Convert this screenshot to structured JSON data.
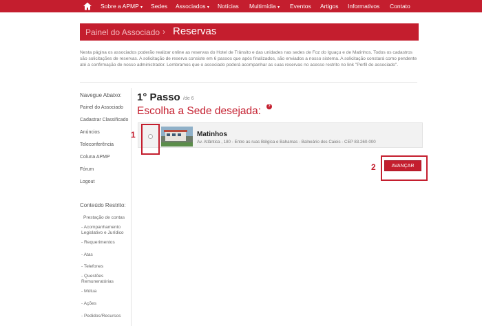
{
  "nav": {
    "items": [
      "Sobre a APMP",
      "Sedes",
      "Associados",
      "Notícias",
      "Multimídia",
      "Eventos",
      "Artigos",
      "Informativos",
      "Contato"
    ],
    "dropdown_items": [
      "Sobre a APMP",
      "Associados",
      "Multimídia"
    ]
  },
  "header": {
    "breadcrumb": "Painel do Associado",
    "separator": "›",
    "title": "Reservas"
  },
  "intro_text": "Nesta página os associados poderão realizar online as reservas do Hotel de Trânsito e das unidades nas sedes de Foz do Iguaçu e de Matinhos. Todos os cadastros são solicitações de reservas. A solicitação de reserva consiste em 6 passos que após finalizados, são enviados a nosso sistema. A solicitação constará como pendente até a confirmação de nosso administrador. Lembramos que o associado poderá acompanhar as suas reservas no acesso restrito no link \"Perfil do associado\".",
  "sidebar": {
    "nav_title": "Navegue Abaixo:",
    "links": [
      "Painel do Associado",
      "Cadastrar Classificado",
      "Anúncios",
      "Teleconferência",
      "Coluna APMP",
      "Fórum",
      "Logout"
    ],
    "restricted_title": "Conteúdo Restrito:",
    "restricted_items": [
      "Prestação de contas",
      "- Acompanhamento Legislativo e Jurídico",
      "- Requerimentos",
      "- Atas",
      "- Telefones",
      "- Questões Remuneratórias",
      "- Mútua",
      "- Ações",
      "- Pedidos/Recursos"
    ]
  },
  "main": {
    "step_title": "1° Passo",
    "step_of": "/de 6",
    "choose_label": "Escolha a Sede desejada:",
    "info_glyph": "?",
    "sede": {
      "name": "Matinhos",
      "address": "Av. Atlântica , 180 - Entre as ruas Bélgica e Bahamas - Balneário dos Caieis - CEP 83.260-000",
      "selected": false
    },
    "next_button": "AVANÇAR"
  },
  "annotations": {
    "marker_1": "1",
    "marker_2": "2"
  },
  "colors": {
    "brand_red": "#c41e2e"
  }
}
